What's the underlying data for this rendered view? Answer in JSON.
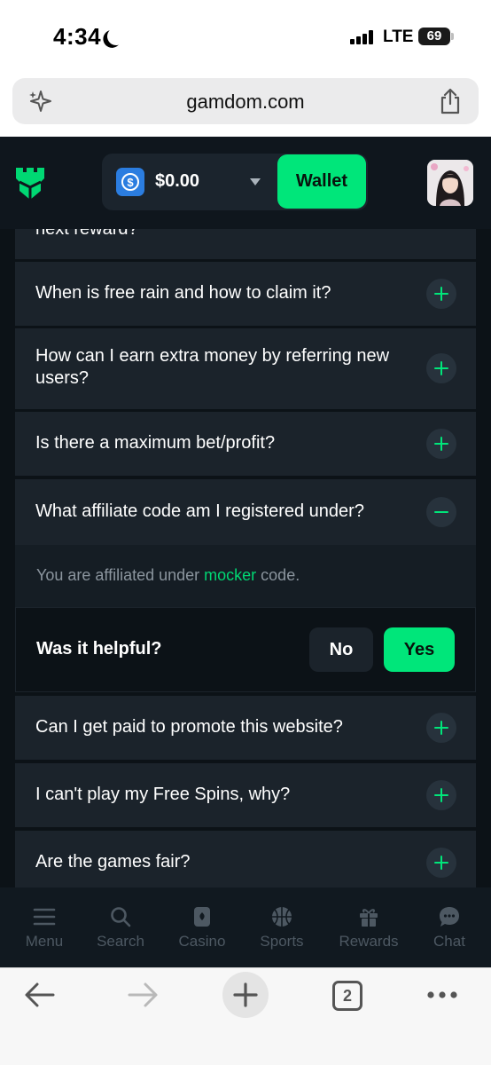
{
  "status_bar": {
    "time": "4:34",
    "network": "LTE",
    "battery": "69"
  },
  "browser": {
    "url": "gamdom.com",
    "tab_count": "2"
  },
  "header": {
    "balance": "$0.00",
    "wallet_label": "Wallet"
  },
  "faq": {
    "partial_question": "next reward?",
    "items": [
      {
        "question": "When is free rain and how to claim it?"
      },
      {
        "question": "How can I earn extra money by referring new users?"
      },
      {
        "question": "Is there a maximum bet/profit?"
      },
      {
        "question": "What affiliate code am I registered under?"
      },
      {
        "question": "Can I get paid to promote this website?"
      },
      {
        "question": "I can't play my Free Spins, why?"
      },
      {
        "question": "Are the games fair?"
      }
    ],
    "answer": {
      "prefix": "You are affiliated under ",
      "code": "mocker",
      "suffix": " code."
    },
    "helpful": {
      "label": "Was it helpful?",
      "no": "No",
      "yes": "Yes"
    }
  },
  "bottom_nav": {
    "menu": "Menu",
    "search": "Search",
    "casino": "Casino",
    "sports": "Sports",
    "rewards": "Rewards",
    "chat": "Chat"
  },
  "colors": {
    "accent": "#00e67a",
    "background": "#0c1217",
    "card": "#1b232b",
    "currency": "#2b7de0"
  }
}
